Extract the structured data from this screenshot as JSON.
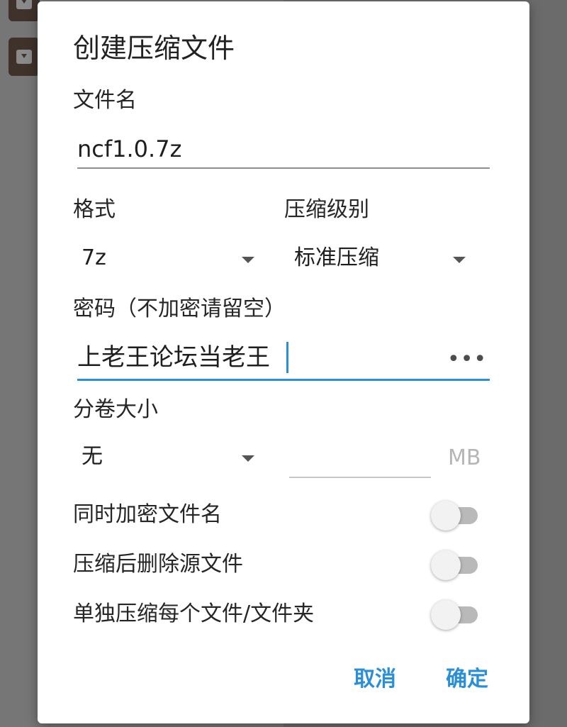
{
  "dialog": {
    "title": "创建压缩文件",
    "filename": {
      "label": "文件名",
      "value": "ncf1.0.7z"
    },
    "format": {
      "label": "格式",
      "selected": "7z"
    },
    "level": {
      "label": "压缩级别",
      "selected": "标准压缩"
    },
    "password": {
      "label": "密码（不加密请留空）",
      "value": "上老王论坛当老王",
      "toggle_glyph": "•••"
    },
    "volume": {
      "label": "分卷大小",
      "selected": "无",
      "size_value": "",
      "unit": "MB"
    },
    "options": [
      {
        "label": "同时加密文件名",
        "on": false
      },
      {
        "label": "压缩后删除源文件",
        "on": false
      },
      {
        "label": "单独压缩每个文件/文件夹",
        "on": false
      }
    ],
    "actions": {
      "cancel": "取消",
      "confirm": "确定"
    }
  },
  "colors": {
    "accent": "#2a8fd6",
    "scrim": "#6b6b6b"
  }
}
